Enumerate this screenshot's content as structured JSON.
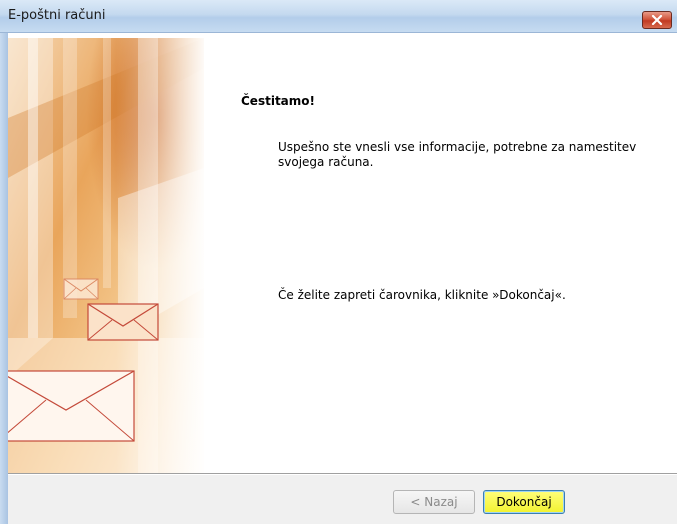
{
  "window": {
    "title": "E-poštni računi"
  },
  "content": {
    "heading": "Čestitamo!",
    "message": "Uspešno ste vnesli vse informacije, potrebne za namestitev svojega računa.",
    "instruction": "Če želite zapreti čarovnika, kliknite »Dokončaj«."
  },
  "buttons": {
    "back": "< Nazaj",
    "finish": "Dokončaj"
  },
  "colors": {
    "accent_orange": "#e58a2a",
    "finish_highlight": "#f2f230",
    "close_red": "#c13a22"
  }
}
